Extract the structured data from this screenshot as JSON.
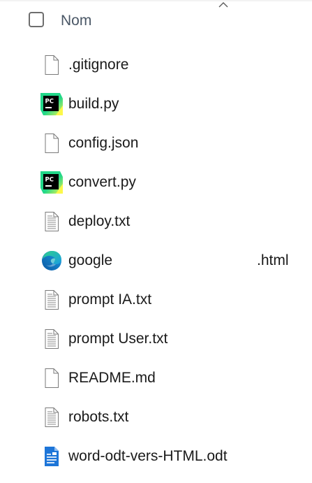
{
  "header": {
    "column_label": "Nom",
    "sort_indicator": "ascending"
  },
  "files": [
    {
      "name": ".gitignore",
      "icon": "blank-file-icon"
    },
    {
      "name": "build.py",
      "icon": "pycharm-icon"
    },
    {
      "name": "config.json",
      "icon": "blank-file-icon"
    },
    {
      "name": "convert.py",
      "icon": "pycharm-icon"
    },
    {
      "name": "deploy.txt",
      "icon": "text-file-icon"
    },
    {
      "name": "google",
      "ext": ".html",
      "icon": "edge-icon"
    },
    {
      "name": "prompt IA.txt",
      "icon": "text-file-icon"
    },
    {
      "name": "prompt User.txt",
      "icon": "text-file-icon"
    },
    {
      "name": "README.md",
      "icon": "blank-file-icon"
    },
    {
      "name": "robots.txt",
      "icon": "text-file-icon"
    },
    {
      "name": "word-odt-vers-HTML.odt",
      "icon": "odt-document-icon"
    }
  ],
  "colors": {
    "pycharm_bg": "#000000",
    "pycharm_gradient_green": "#21D789",
    "pycharm_gradient_yellow": "#FCF84A",
    "edge_blue": "#0C59A4",
    "edge_green": "#2FD08A",
    "odt_blue": "#1D75D8"
  }
}
